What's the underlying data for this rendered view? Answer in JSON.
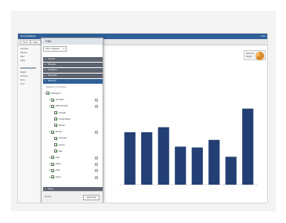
{
  "app": {
    "title": "ServicesBright",
    "help": "Help"
  },
  "toolbar": {
    "buttons": [
      "Home",
      "Share"
    ]
  },
  "sidebar": {
    "items": [
      "Favorites",
      "Reports",
      "Filter",
      "Sales",
      "Region",
      "Products",
      "Store",
      "Time"
    ]
  },
  "panel": {
    "title": "Filter",
    "select_value": "Filter 1 (Region)",
    "sections": [
      "General",
      "Schedule",
      "Conditions",
      "Dimension",
      "Hierarchy"
    ],
    "filter_heading": "Selected: 3 of 12 items",
    "tree": [
      {
        "label": "All Regions",
        "level": 0
      },
      {
        "label": "Americas",
        "level": 1
      },
      {
        "label": "North America",
        "level": 1
      },
      {
        "label": "Canada",
        "level": 2
      },
      {
        "label": "United States",
        "level": 2
      },
      {
        "label": "Mexico",
        "level": 2
      },
      {
        "label": "Europe",
        "level": 1
      },
      {
        "label": "Germany",
        "level": 2
      },
      {
        "label": "France",
        "level": 2
      },
      {
        "label": "Italy",
        "level": 2
      },
      {
        "label": "Asia",
        "level": 1
      },
      {
        "label": "Japan",
        "level": 1
      },
      {
        "label": "India",
        "level": 1
      },
      {
        "label": "China",
        "level": 1
      }
    ],
    "bottom_section": "Pages",
    "footer_text": "Results",
    "apply_label": "Apply Filter"
  },
  "selection_box": {
    "line1": "Selected",
    "line2": "Region"
  },
  "chart_data": {
    "type": "bar",
    "categories": [
      "",
      "",
      "",
      "",
      "",
      "",
      "",
      ""
    ],
    "values": [
      62,
      62,
      68,
      45,
      44,
      53,
      33,
      90
    ],
    "ylim": [
      0,
      100
    ],
    "xlabel": "",
    "ylabel": "",
    "bar_color": "#233f73"
  }
}
